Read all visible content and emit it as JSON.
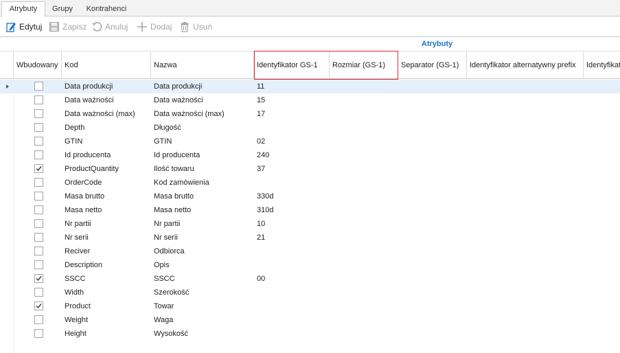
{
  "tabs": [
    "Atrybuty",
    "Grupy",
    "Kontrahenci"
  ],
  "toolbar": {
    "edit": "Edytuj",
    "save": "Zapisz",
    "cancel": "Anuluj",
    "add": "Dodaj",
    "delete": "Usuń"
  },
  "grid": {
    "band_title": "Atrybuty",
    "columns": [
      "Wbudowany",
      "Kod",
      "Nazwa",
      "Identyfikator GS-1",
      "Rozmiar (GS-1)",
      "Separator (GS-1)",
      "Identyfikator alternatywny prefix",
      "Identyfikator"
    ],
    "rows": [
      {
        "builtin": false,
        "code": "Data produkcji",
        "name": "Data produkcji",
        "gs1": "11"
      },
      {
        "builtin": false,
        "code": "Data ważności",
        "name": "Data ważności",
        "gs1": "15"
      },
      {
        "builtin": false,
        "code": "Data ważności (max)",
        "name": "Data ważności (max)",
        "gs1": "17"
      },
      {
        "builtin": false,
        "code": "Depth",
        "name": "Długość",
        "gs1": ""
      },
      {
        "builtin": false,
        "code": "GTIN",
        "name": "GTIN",
        "gs1": "02"
      },
      {
        "builtin": false,
        "code": "Id producenta",
        "name": "Id producenta",
        "gs1": "240"
      },
      {
        "builtin": true,
        "code": "ProductQuantity",
        "name": "Ilość towaru",
        "gs1": "37"
      },
      {
        "builtin": false,
        "code": "OrderCode",
        "name": "Kod zamówienia",
        "gs1": ""
      },
      {
        "builtin": false,
        "code": "Masa brutto",
        "name": "Masa brutto",
        "gs1": "330d"
      },
      {
        "builtin": false,
        "code": "Masa netto",
        "name": "Masa netto",
        "gs1": "310d"
      },
      {
        "builtin": false,
        "code": "Nr partii",
        "name": "Nr partii",
        "gs1": "10"
      },
      {
        "builtin": false,
        "code": "Nr serii",
        "name": "Nr serii",
        "gs1": "21"
      },
      {
        "builtin": false,
        "code": "Reciver",
        "name": "Odbiorca",
        "gs1": ""
      },
      {
        "builtin": false,
        "code": "Description",
        "name": "Opis",
        "gs1": ""
      },
      {
        "builtin": true,
        "code": "SSCC",
        "name": "SSCC",
        "gs1": "00"
      },
      {
        "builtin": false,
        "code": "Width",
        "name": "Szerokość",
        "gs1": ""
      },
      {
        "builtin": true,
        "code": "Product",
        "name": "Towar",
        "gs1": ""
      },
      {
        "builtin": false,
        "code": "Weight",
        "name": "Waga",
        "gs1": ""
      },
      {
        "builtin": false,
        "code": "Height",
        "name": "Wysokość",
        "gs1": ""
      }
    ]
  },
  "colors": {
    "accent": "#1b73c9",
    "highlight_border": "#e0282e",
    "selected_row": "#e6f0fb"
  }
}
